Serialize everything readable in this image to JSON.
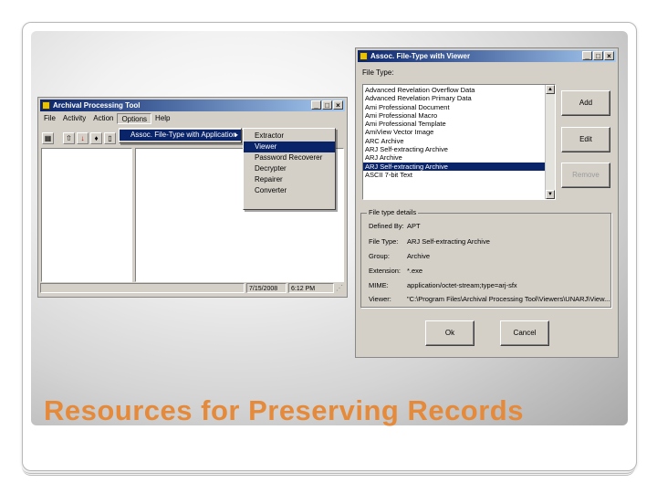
{
  "slide": {
    "title": "Resources for Preserving Records"
  },
  "apt_window": {
    "title": "Archival Processing Tool",
    "title_buttons": [
      "_",
      "□",
      "×"
    ],
    "menu": [
      "File",
      "Activity",
      "Action",
      "Options",
      "Help"
    ],
    "status": {
      "date": "7/15/2008",
      "time": "6:12 PM"
    }
  },
  "options_menu": {
    "items": [
      {
        "label": "Assoc. File-Type with Application",
        "has_submenu": true,
        "selected": true
      }
    ],
    "submenu": [
      "Extractor",
      "Viewer",
      "Password Recoverer",
      "Decrypter",
      "Repairer",
      "Converter"
    ],
    "submenu_selected": "Viewer"
  },
  "assoc_dialog": {
    "title": "Assoc. File-Type with Viewer",
    "title_buttons": [
      "_",
      "□",
      "×"
    ],
    "filetype_label": "File Type:",
    "file_types": [
      "Advanced Revelation Overflow Data",
      "Advanced Revelation Primary Data",
      "Ami Professional Document",
      "Ami Professional Macro",
      "Ami Professional Template",
      "AmiView Vector Image",
      "ARC Archive",
      "ARJ Self-extracting Archive",
      "ARJ Archive",
      "ARJ Self-extracting Archive",
      "ASCII 7-bit Text"
    ],
    "selected_index": 9,
    "buttons": {
      "add": "Add",
      "edit": "Edit",
      "remove": "Remove",
      "ok": "Ok",
      "cancel": "Cancel"
    },
    "details": {
      "caption": "File type details",
      "rows": [
        {
          "key": "Defined By:",
          "value": "APT"
        },
        {
          "key": "File Type:",
          "value": "ARJ Self-extracting Archive"
        },
        {
          "key": "Group:",
          "value": "Archive"
        },
        {
          "key": "Extension:",
          "value": "*.exe"
        },
        {
          "key": "MIME:",
          "value": "application/octet-stream;type=arj-sfx"
        },
        {
          "key": "Viewer:",
          "value": "\"C:\\Program Files\\Archival Processing Tool\\Viewers\\UNARJ\\View..."
        }
      ]
    }
  }
}
